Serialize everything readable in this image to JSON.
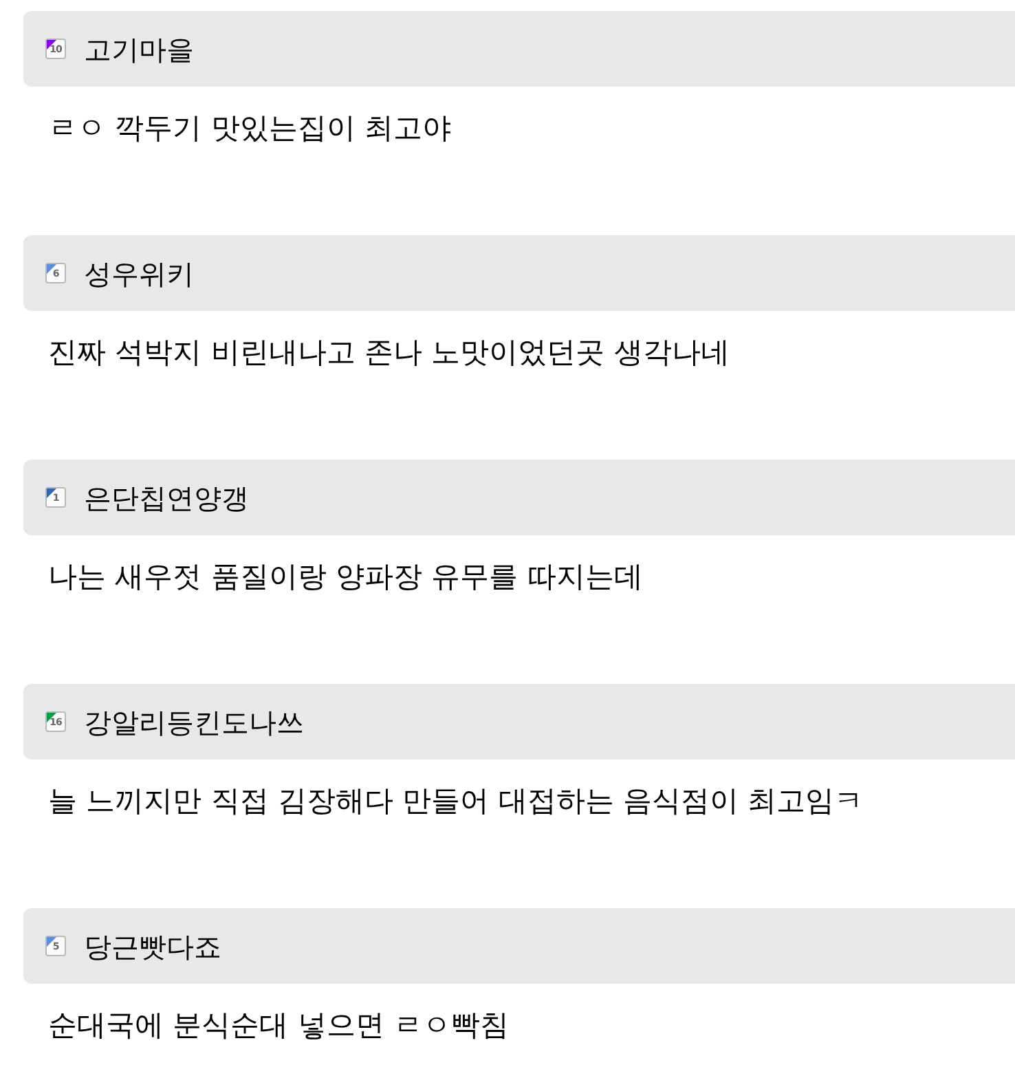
{
  "comments": [
    {
      "author": "고기마을",
      "badge": "10",
      "color": "#8800f0",
      "text": "ㄹㅇ 깍두기 맛있는집이 최고야"
    },
    {
      "author": "성우위키",
      "badge": "6",
      "color": "#5b8fdc",
      "text": "진짜 석박지 비린내나고 존나 노맛이었던곳 생각나네"
    },
    {
      "author": "은단칩연양갱",
      "badge": "1",
      "color": "#3366b0",
      "text": "나는 새우젓 품질이랑 양파장 유무를 따지는데"
    },
    {
      "author": "강알리등킨도나쓰",
      "badge": "16",
      "color": "#00a04a",
      "text": "늘 느끼지만 직접 김장해다 만들어 대접하는 음식점이 최고임ㅋ"
    },
    {
      "author": "당근빳다죠",
      "badge": "5",
      "color": "#5b8fdc",
      "text": "순대국에 분식순대 넣으면 ㄹㅇ빡침"
    }
  ]
}
